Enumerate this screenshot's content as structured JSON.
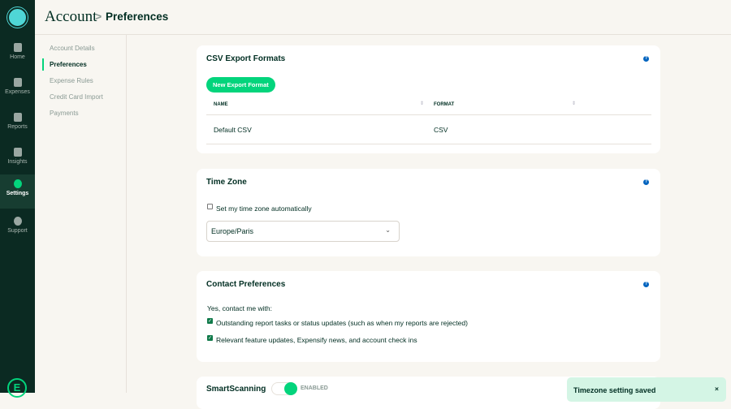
{
  "nav": {
    "items": [
      {
        "label": "Home"
      },
      {
        "label": "Expenses"
      },
      {
        "label": "Reports"
      },
      {
        "label": "Insights"
      },
      {
        "label": "Settings",
        "active": true
      },
      {
        "label": "Support"
      }
    ],
    "footer_logo": "E"
  },
  "header": {
    "section": "Account",
    "separator": ">",
    "page": "Preferences"
  },
  "subnav": {
    "items": [
      "Account Details",
      "Preferences",
      "Expense Rules",
      "Credit Card Import",
      "Payments"
    ]
  },
  "csv": {
    "title": "CSV Export Formats",
    "help": "?",
    "button": "New Export Format",
    "columns": [
      "NAME",
      "FORMAT"
    ],
    "rows": [
      {
        "name": "Default CSV",
        "format": "CSV"
      }
    ]
  },
  "timezone": {
    "title": "Time Zone",
    "help": "?",
    "auto_label": "Set my time zone automatically",
    "auto_checked": false,
    "selected": "Europe/Paris"
  },
  "contact": {
    "title": "Contact Preferences",
    "help": "?",
    "intro": "Yes, contact me with:",
    "options": [
      {
        "label": "Outstanding report tasks or status updates (such as when my reports are rejected)",
        "checked": true
      },
      {
        "label": "Relevant feature updates, Expensify news, and account check ins",
        "checked": true
      }
    ]
  },
  "smartscan": {
    "title": "SmartScanning",
    "status": "ENABLED"
  },
  "toast": {
    "message": "Timezone setting saved",
    "close": "×"
  },
  "colors": {
    "accent": "#03d47c",
    "nav_bg": "#0b2a22"
  }
}
